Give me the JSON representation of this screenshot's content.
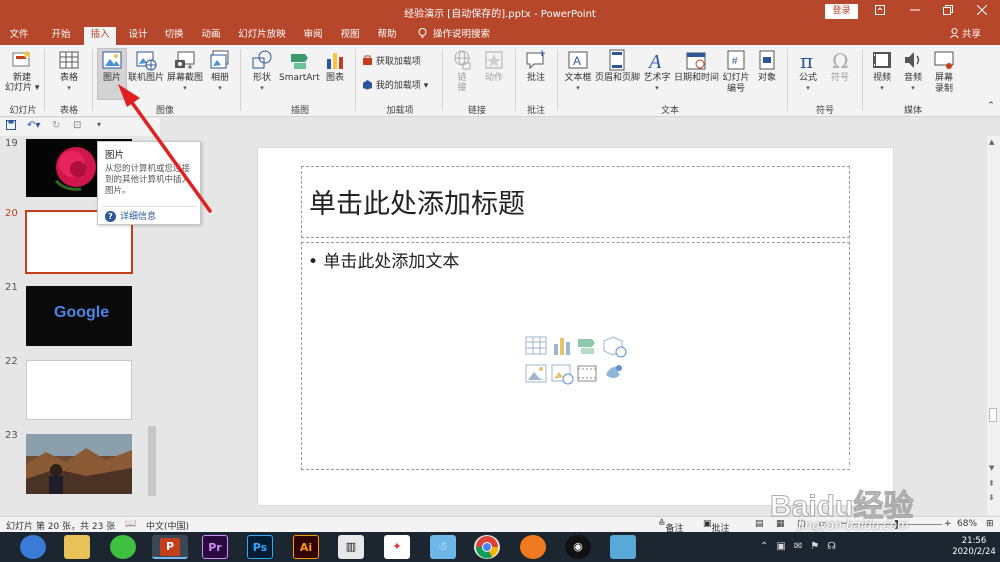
{
  "window": {
    "title": "经验演示 [自动保存的].pptx  -  PowerPoint",
    "login_label": "登录",
    "minimize_glyph": "🗖",
    "restore_glyph": "❐",
    "close_glyph": "✕",
    "ribbon_collapse_glyph": "▢"
  },
  "tabs": [
    {
      "label": "文件"
    },
    {
      "label": "开始"
    },
    {
      "label": "插入"
    },
    {
      "label": "设计"
    },
    {
      "label": "切换"
    },
    {
      "label": "动画"
    },
    {
      "label": "幻灯片放映"
    },
    {
      "label": "审阅"
    },
    {
      "label": "视图"
    },
    {
      "label": "帮助"
    }
  ],
  "tell_me": "操作说明搜索",
  "share": "共享",
  "ribbon": {
    "new_slide": "新建\n幻灯片",
    "table": "表格",
    "picture": "图片",
    "online_pictures": "联机图片",
    "screenshot": "屏幕截图",
    "album": "相册",
    "shapes": "形状",
    "smartart": "SmartArt",
    "chart": "图表",
    "get_addins": "获取加载项",
    "my_addins": "我的加载项",
    "link": "链接",
    "action": "动作",
    "comment": "批注",
    "textbox": "文本框",
    "header_footer": "页眉和页脚",
    "wordart": "艺术字",
    "date_time": "日期和时间",
    "slide_number_1": "幻灯片",
    "slide_number_2": "编号",
    "object": "对象",
    "equation": "公式",
    "symbol": "符号",
    "video": "视频",
    "audio": "音频",
    "screen_rec_1": "屏幕",
    "screen_rec_2": "录制",
    "groups": {
      "slides": "幻灯片",
      "tables": "表格",
      "images": "图像",
      "illustrations": "插图",
      "addins": "加载项",
      "links": "链接",
      "comments": "批注",
      "text": "文本",
      "symbols": "符号",
      "media": "媒体"
    }
  },
  "tooltip": {
    "title": "图片",
    "description": "从您的计算机或您连接到的其他计算机中插入图片。",
    "more_info": "详细信息"
  },
  "thumbnails": [
    {
      "num": "19"
    },
    {
      "num": "20"
    },
    {
      "num": "21",
      "text": "Google"
    },
    {
      "num": "22"
    },
    {
      "num": "23"
    }
  ],
  "slide": {
    "title_placeholder": "单击此处添加标题",
    "body_placeholder": "• 单击此处添加文本"
  },
  "status": {
    "slide_info": "幻灯片 第 20 张，共 23 张",
    "language": "中文(中国)",
    "notes": "备注",
    "comments": "批注",
    "zoom": "68%"
  },
  "taskbar": {
    "time": "21:56",
    "date": "2020/2/24",
    "apps": [
      {
        "name": "browser"
      },
      {
        "name": "file-explorer"
      },
      {
        "name": "wechat"
      },
      {
        "name": "powerpoint",
        "label": "P"
      },
      {
        "name": "premiere",
        "label": "Pr"
      },
      {
        "name": "photoshop",
        "label": "Ps"
      },
      {
        "name": "illustrator",
        "label": "Ai"
      },
      {
        "name": "video-editor"
      },
      {
        "name": "app-red"
      },
      {
        "name": "app-snowman"
      },
      {
        "name": "chrome"
      },
      {
        "name": "app-orange"
      },
      {
        "name": "qq"
      },
      {
        "name": "app-blue"
      }
    ]
  },
  "watermark": {
    "logo_text": "Baidu经验",
    "url": "jingyan.baidu.com"
  },
  "colors": {
    "accent": "#b7472a",
    "current_slide": "#c43e1c"
  }
}
